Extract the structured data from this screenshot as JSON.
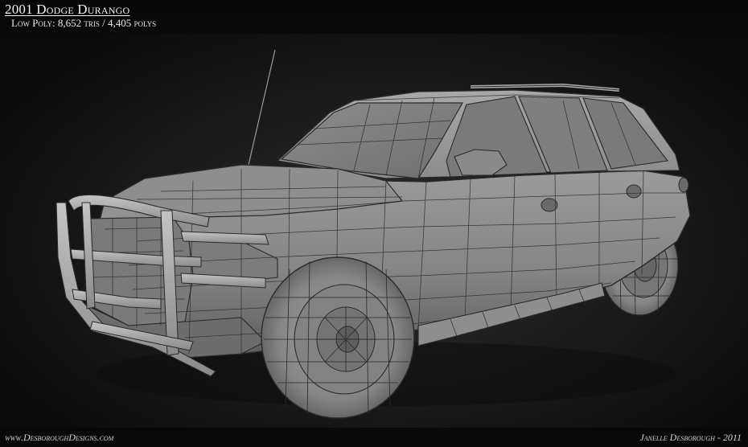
{
  "header": {
    "title": "2001 Dodge Durango",
    "subtitle": "Low Poly: 8,652 tris / 4,405 polys"
  },
  "footer": {
    "website": "www.DesboroughDesigns.com",
    "credit": "Janelle Desborough - 2011"
  },
  "render": {
    "subject": "wireframe-suv",
    "colors": {
      "body": "#8a8a8a",
      "wire": "#2a2a2a",
      "background": "#1e1e1e",
      "bars": "#b0b0b0"
    }
  }
}
